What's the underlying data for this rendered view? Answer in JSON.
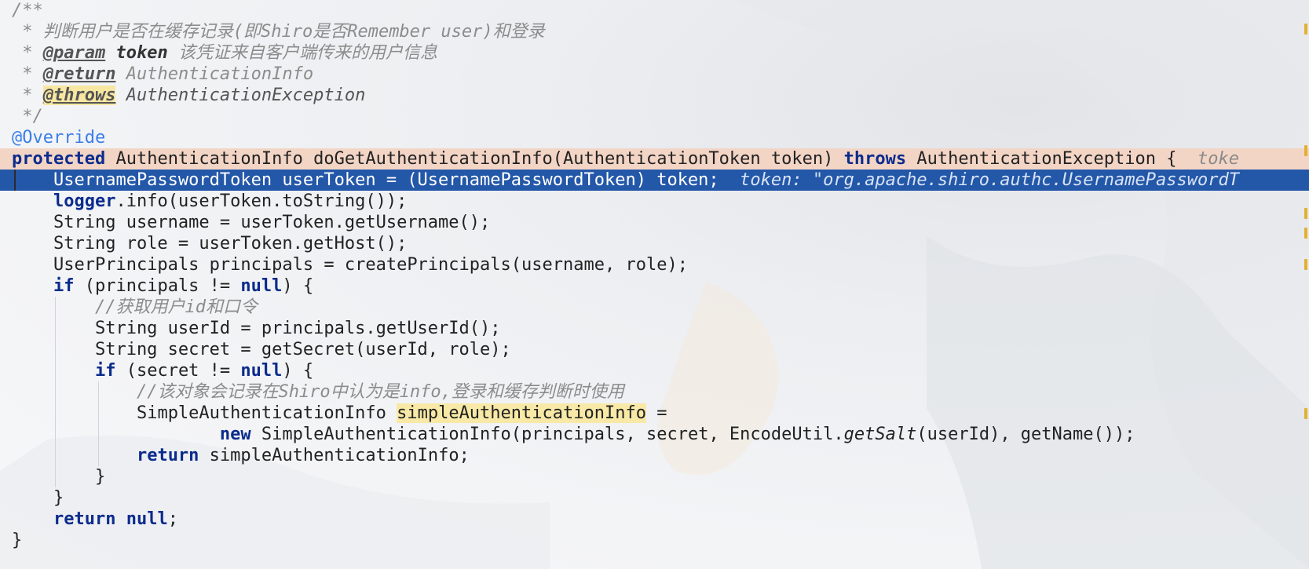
{
  "editor": {
    "lines": [
      {
        "kind": "comment",
        "text": "/**"
      },
      {
        "kind": "comment",
        "text": " * 判断用户是否在缓存记录(即Shiro是否Remember user)和登录"
      },
      {
        "kind": "param",
        "star": " * ",
        "tag": "@param",
        "name": "token",
        "desc": "该凭证来自客户端传来的用户信息"
      },
      {
        "kind": "return",
        "star": " * ",
        "tag": "@return",
        "type": "AuthenticationInfo"
      },
      {
        "kind": "throws",
        "star": " * ",
        "tag": "@throws",
        "type": "AuthenticationException"
      },
      {
        "kind": "comment",
        "text": " */"
      },
      {
        "kind": "annotation",
        "text": "@Override"
      },
      {
        "kind": "signature",
        "kw1": "protected",
        "mid": " AuthenticationInfo doGetAuthenticationInfo(AuthenticationToken token) ",
        "kw2": "throws",
        "tail": " AuthenticationException {  ",
        "hint": "toke"
      },
      {
        "kind": "selected",
        "code": "    UsernamePasswordToken userToken = (UsernamePasswordToken) token;  ",
        "hint": "token: \"org.apache.shiro.authc.UsernamePasswordT"
      },
      {
        "kind": "logger",
        "indent": "    ",
        "field": "logger",
        "rest": ".info(userToken.toString());"
      },
      {
        "kind": "plain",
        "text": "    String username = userToken.getUsername();"
      },
      {
        "kind": "plain",
        "text": "    String role = userToken.getHost();"
      },
      {
        "kind": "plain",
        "text": "    UserPrincipals principals = createPrincipals(username, role);"
      },
      {
        "kind": "if",
        "indent": "    ",
        "kw": "if",
        "mid": " (principals != ",
        "kw2": "null",
        "tail": ") {"
      },
      {
        "kind": "linecomment",
        "indent": "        ",
        "text": "//获取用户id和口令"
      },
      {
        "kind": "plain",
        "text": "        String userId = principals.getUserId();"
      },
      {
        "kind": "plain",
        "text": "        String secret = getSecret(userId, role);"
      },
      {
        "kind": "if",
        "indent": "        ",
        "kw": "if",
        "mid": " (secret != ",
        "kw2": "null",
        "tail": ") {"
      },
      {
        "kind": "linecomment",
        "indent": "            ",
        "text": "//该对象会记录在Shiro中认为是info,登录和缓存判断时使用"
      },
      {
        "kind": "decl",
        "indent": "            ",
        "type": "SimpleAuthenticationInfo ",
        "var": "simpleAuthenticationInfo",
        "tail": " ="
      },
      {
        "kind": "new",
        "indent": "                    ",
        "kw": "new",
        "mid": " SimpleAuthenticationInfo(principals, secret, EncodeUtil.",
        "static": "getSalt",
        "tail": "(userId), getName());"
      },
      {
        "kind": "return",
        "indent": "            ",
        "kw": "return",
        "tail": " simpleAuthenticationInfo;"
      },
      {
        "kind": "plain",
        "text": "        }"
      },
      {
        "kind": "plain",
        "text": "    }"
      },
      {
        "kind": "retnull",
        "indent": "    ",
        "kw": "return",
        "sp": " ",
        "kw2": "null",
        "tail": ";"
      },
      {
        "kind": "plain",
        "text": "}"
      }
    ]
  }
}
